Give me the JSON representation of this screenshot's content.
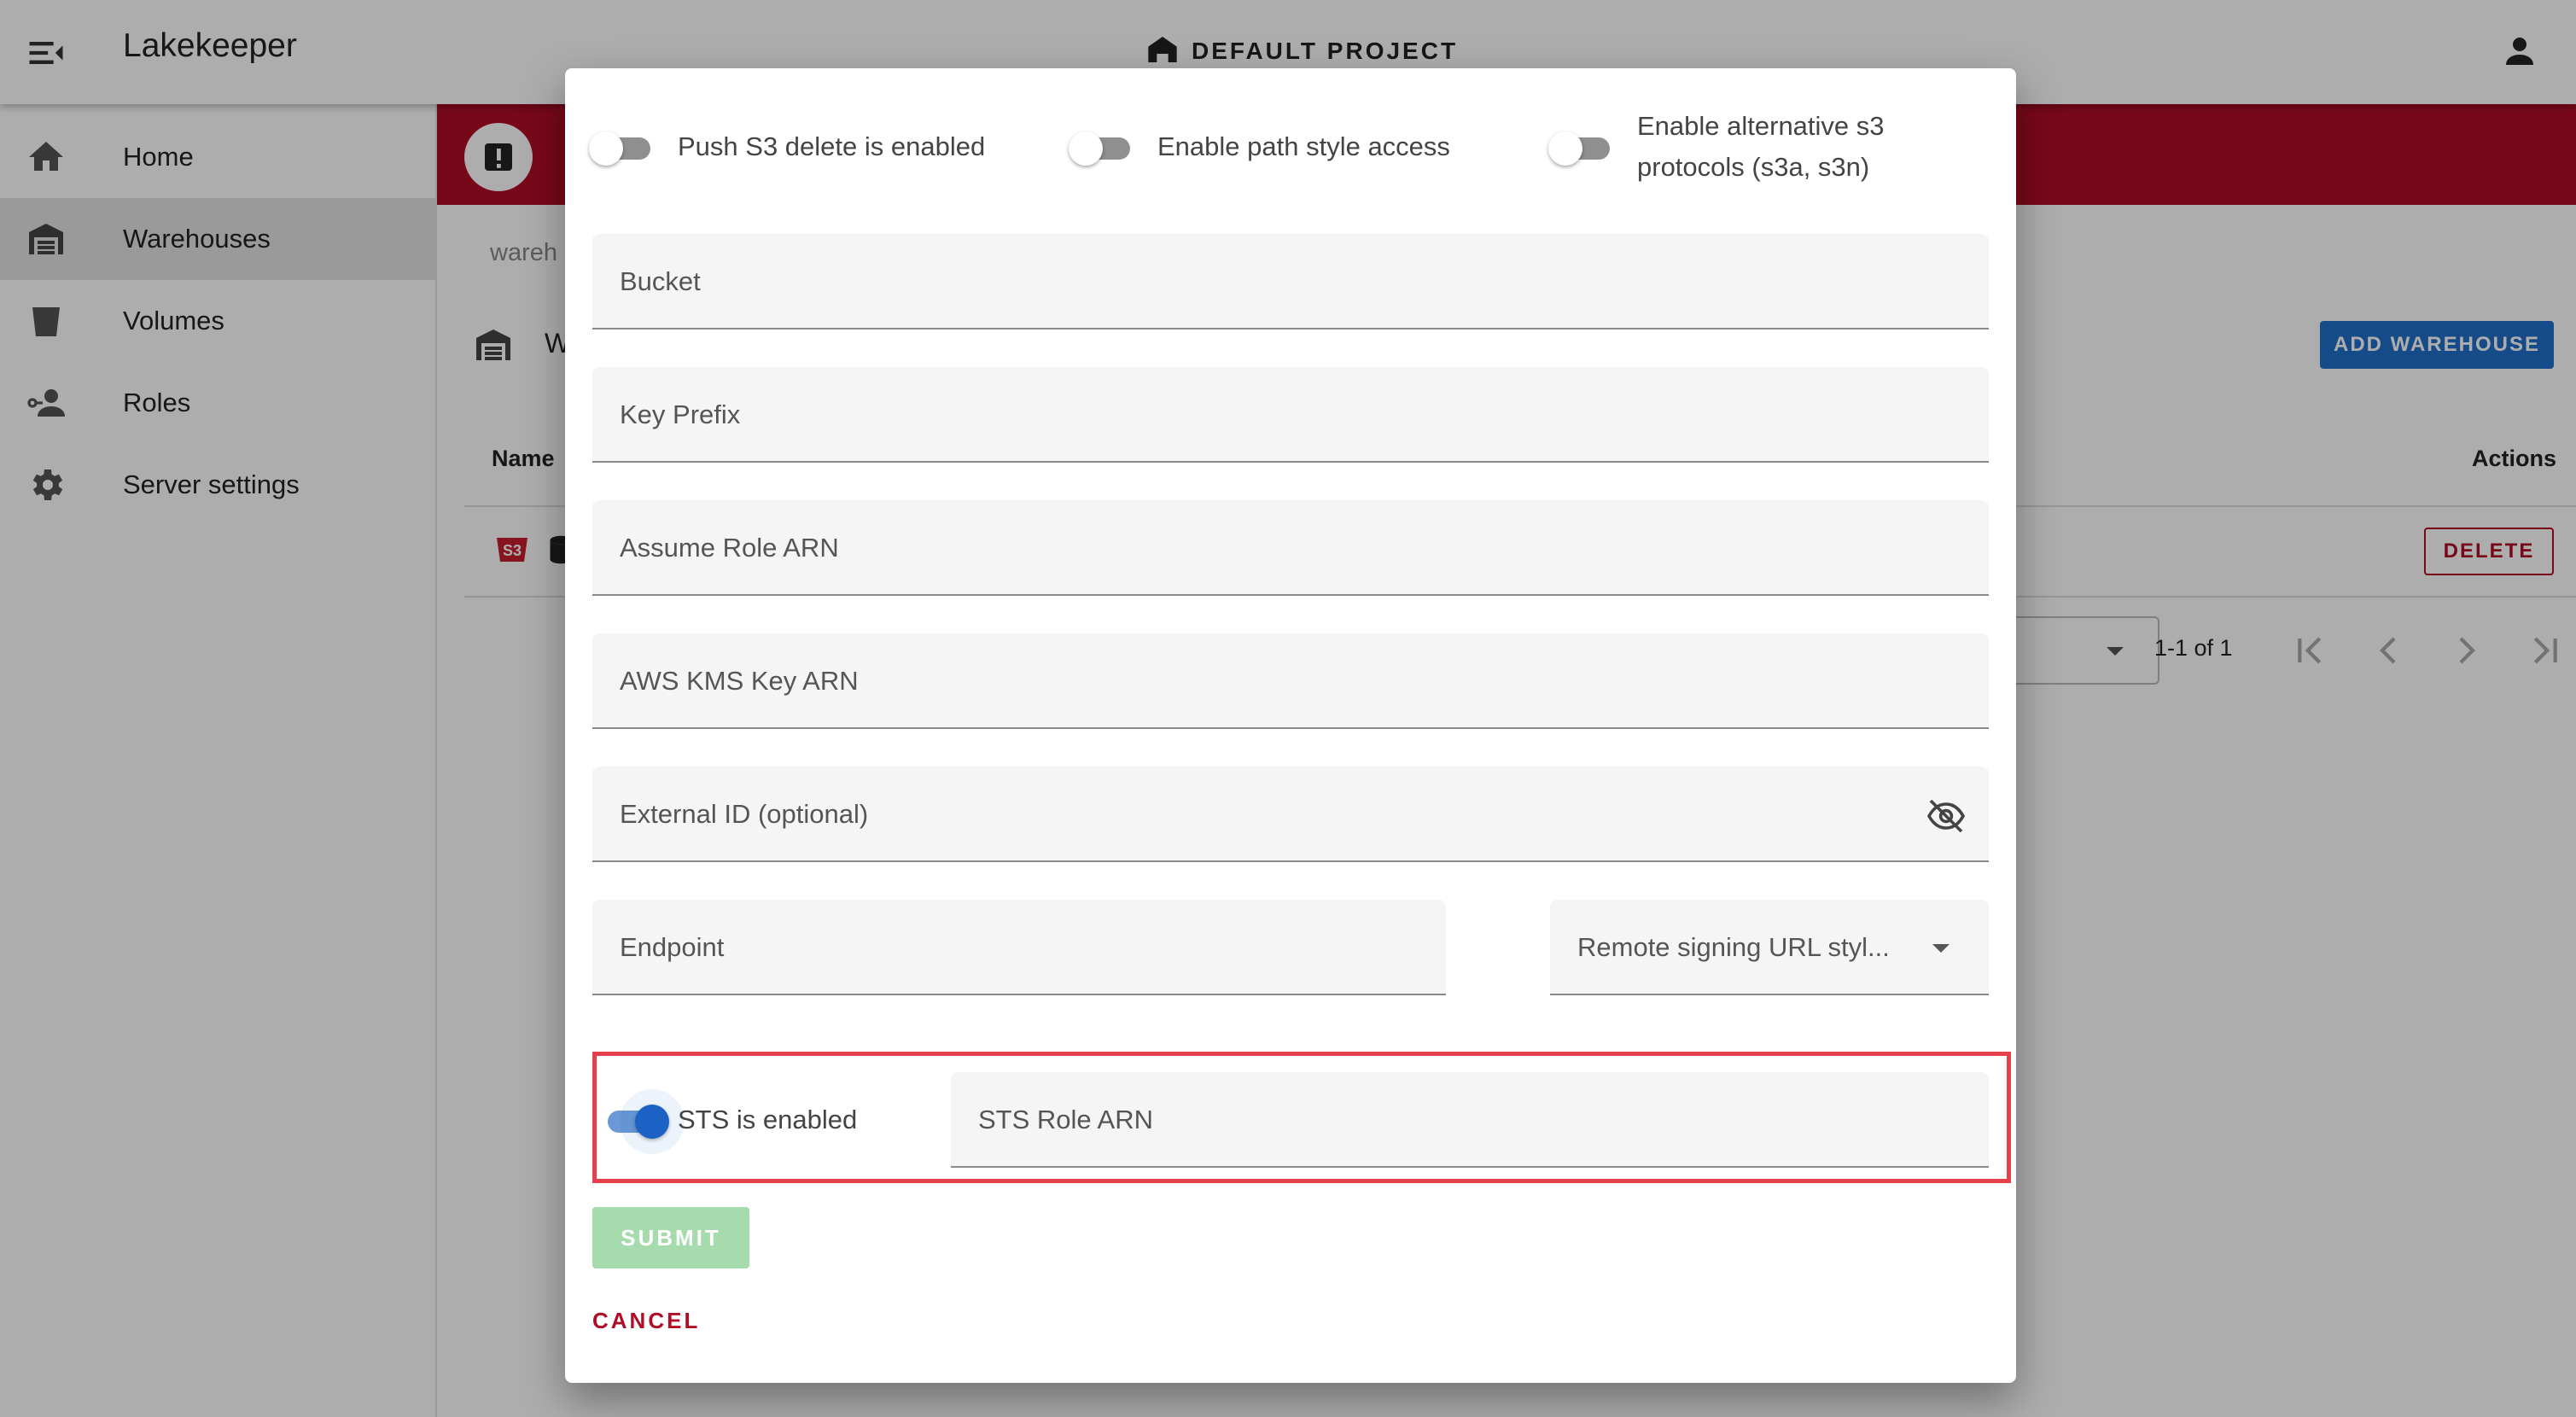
{
  "appbar": {
    "title": "Lakekeeper",
    "project_label": "DEFAULT PROJECT"
  },
  "drawer": {
    "items": [
      {
        "label": "Home",
        "icon": "home-icon"
      },
      {
        "label": "Warehouses",
        "icon": "warehouse-icon",
        "active": true
      },
      {
        "label": "Volumes",
        "icon": "bucket-icon"
      },
      {
        "label": "Roles",
        "icon": "roles-icon"
      },
      {
        "label": "Server settings",
        "icon": "gear-icon"
      }
    ]
  },
  "main": {
    "breadcrumb": "wareh",
    "title": "W",
    "add_button": "ADD WAREHOUSE",
    "table": {
      "header_name": "Name",
      "header_actions": "Actions",
      "delete_label": "DELETE"
    },
    "pagination": {
      "range": "1-1 of 1"
    }
  },
  "dialog": {
    "toggles": {
      "push_s3_delete": {
        "label": "Push S3 delete is enabled",
        "on": false
      },
      "path_style": {
        "label": "Enable path style access",
        "on": false
      },
      "alt_protocols": {
        "label_line1": "Enable alternative s3",
        "label_line2": "protocols (s3a, s3n)",
        "on": false
      },
      "sts": {
        "label": "STS is enabled",
        "on": true
      }
    },
    "fields": {
      "bucket": "Bucket",
      "key_prefix": "Key Prefix",
      "assume_role_arn": "Assume Role ARN",
      "kms_key_arn": "AWS KMS Key ARN",
      "external_id": "External ID (optional)",
      "endpoint": "Endpoint",
      "remote_signing": "Remote signing URL styl...",
      "sts_role_arn": "STS Role ARN"
    },
    "submit_label": "SUBMIT",
    "cancel_label": "CANCEL"
  },
  "colors": {
    "banner": "#b10d26",
    "primary": "#1e6fc9",
    "submit_disabled": "#a6dcad",
    "highlight": "#e5404b"
  }
}
